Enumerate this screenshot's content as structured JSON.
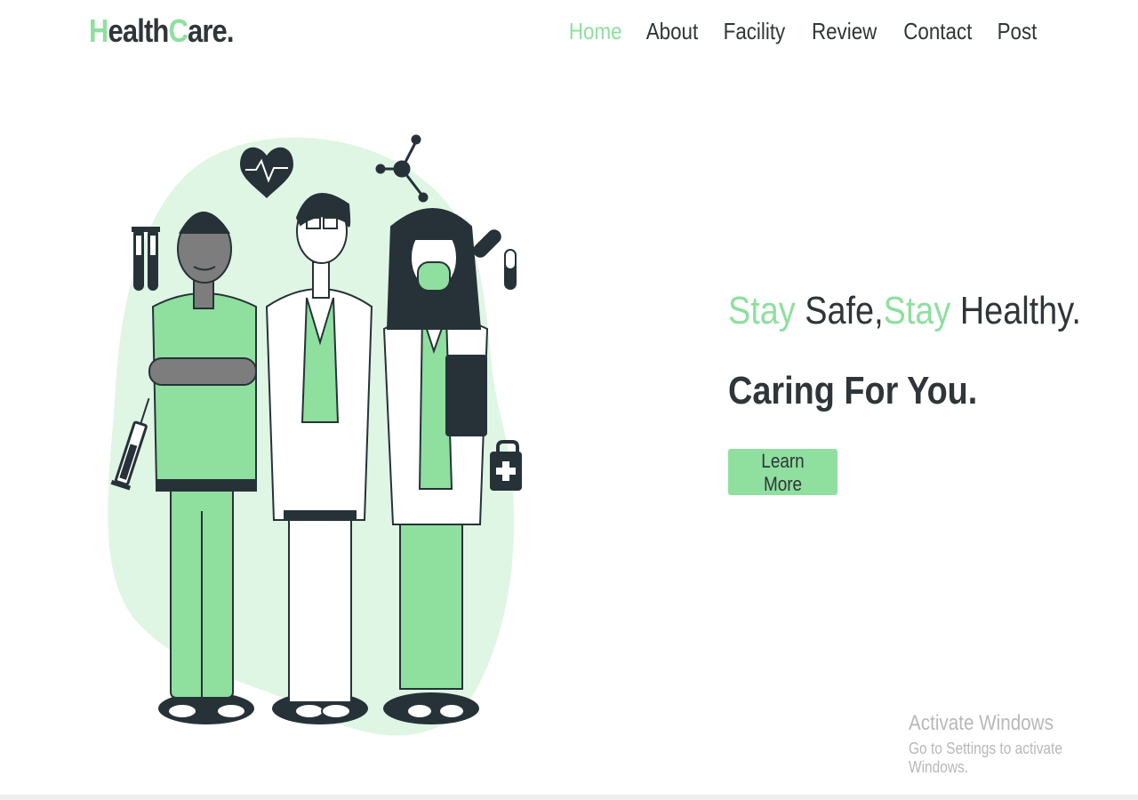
{
  "brand": {
    "first_letter": "H",
    "first_rest": "ealth",
    "second_letter": "C",
    "second_rest": "are."
  },
  "nav": {
    "items": [
      {
        "label": "Home",
        "active": true
      },
      {
        "label": "About"
      },
      {
        "label": "Facility"
      },
      {
        "label": "Review"
      },
      {
        "label": "Contact"
      },
      {
        "label": "Post"
      }
    ]
  },
  "hero": {
    "headline": {
      "stay1": "Stay",
      "safe": " Safe,",
      "stay2": "Stay",
      "healthy": " Healthy."
    },
    "subline": "Caring For You.",
    "cta": "Learn More"
  },
  "system": {
    "activate_title": "Activate Windows",
    "activate_sub": "Go to Settings to activate Windows."
  },
  "colors": {
    "accent": "#8fdf9f",
    "text": "#2f3539",
    "blob": "#dff6e4",
    "dark": "#263238"
  }
}
